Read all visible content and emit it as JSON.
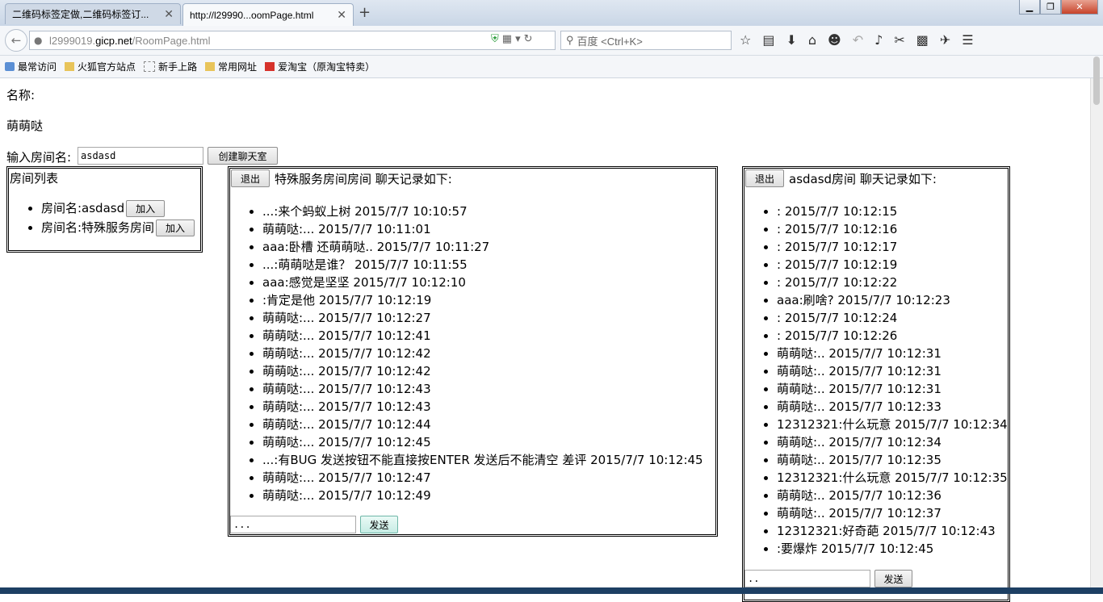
{
  "browser": {
    "tabs": [
      {
        "title": "二维码标签定做,二维码标签订..."
      },
      {
        "title": "http://l29990...oomPage.html"
      }
    ],
    "url_prefix": "l2999019.",
    "url_domain": "gicp.net",
    "url_path": "/RoomPage.html",
    "search_placeholder": "百度 <Ctrl+K>",
    "bookmarks": [
      "最常访问",
      "火狐官方站点",
      "新手上路",
      "常用网址",
      "爱淘宝（原淘宝特卖）"
    ],
    "win_min": "▁",
    "win_max": "❐",
    "win_close": "✕",
    "new_tab": "+",
    "tab_close": "✕"
  },
  "page": {
    "name_label": "名称:",
    "user_name": "萌萌哒",
    "room_input_label": "输入房间名:",
    "room_input_value": "asdasd",
    "create_button": "创建聊天室",
    "room_list": {
      "title": "房间列表",
      "rooms": [
        {
          "name": "房间名:asdasd",
          "join": "加入"
        },
        {
          "name": "房间名:特殊服务房间",
          "join": "加入"
        }
      ]
    },
    "chat1": {
      "exit": "退出",
      "title": "特殊服务房间房间 聊天记录如下:",
      "messages": [
        "...:来个蚂蚁上树 2015/7/7 10:10:57",
        "萌萌哒:... 2015/7/7 10:11:01",
        "aaa:卧槽 还萌萌哒.. 2015/7/7 10:11:27",
        "...:萌萌哒是谁？ 2015/7/7 10:11:55",
        "aaa:感觉是坚坚 2015/7/7 10:12:10",
        ":肯定是他 2015/7/7 10:12:19",
        "萌萌哒:... 2015/7/7 10:12:27",
        "萌萌哒:... 2015/7/7 10:12:41",
        "萌萌哒:... 2015/7/7 10:12:42",
        "萌萌哒:... 2015/7/7 10:12:42",
        "萌萌哒:... 2015/7/7 10:12:43",
        "萌萌哒:... 2015/7/7 10:12:43",
        "萌萌哒:... 2015/7/7 10:12:44",
        "萌萌哒:... 2015/7/7 10:12:45",
        "...:有BUG 发送按钮不能直接按ENTER 发送后不能清空 差评 2015/7/7 10:12:45",
        "萌萌哒:... 2015/7/7 10:12:47",
        "萌萌哒:... 2015/7/7 10:12:49"
      ],
      "input_value": "...",
      "send": "发送"
    },
    "chat2": {
      "exit": "退出",
      "title": "asdasd房间 聊天记录如下:",
      "messages": [
        ": 2015/7/7 10:12:15",
        ": 2015/7/7 10:12:16",
        ": 2015/7/7 10:12:17",
        ": 2015/7/7 10:12:19",
        ": 2015/7/7 10:12:22",
        "aaa:刷啥? 2015/7/7 10:12:23",
        ": 2015/7/7 10:12:24",
        ": 2015/7/7 10:12:26",
        "萌萌哒:.. 2015/7/7 10:12:31",
        "萌萌哒:.. 2015/7/7 10:12:31",
        "萌萌哒:.. 2015/7/7 10:12:31",
        "萌萌哒:.. 2015/7/7 10:12:33",
        "12312321:什么玩意 2015/7/7 10:12:34",
        "萌萌哒:.. 2015/7/7 10:12:34",
        "萌萌哒:.. 2015/7/7 10:12:35",
        "12312321:什么玩意 2015/7/7 10:12:35",
        "萌萌哒:.. 2015/7/7 10:12:36",
        "萌萌哒:.. 2015/7/7 10:12:37",
        "12312321:好奇葩 2015/7/7 10:12:43",
        ":要爆炸 2015/7/7 10:12:45"
      ],
      "input_value": "..",
      "send": "发送"
    }
  }
}
